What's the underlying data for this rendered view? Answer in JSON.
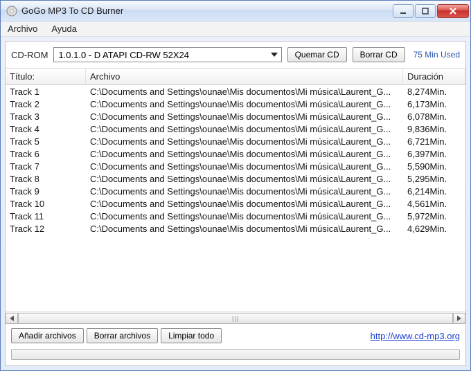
{
  "window": {
    "title": "GoGo MP3 To CD Burner"
  },
  "menu": {
    "archivo": "Archivo",
    "ayuda": "Ayuda"
  },
  "toolbar": {
    "cdrom_label": "CD-ROM",
    "drive_value": "1.0.1.0 - D  ATAPI   CD-RW 52X24",
    "burn_label": "Quemar CD",
    "erase_label": "Borrar CD",
    "min_used": "75 Min Used"
  },
  "columns": {
    "title": "Título:",
    "file": "Archivo",
    "duration": "Duración"
  },
  "tracks": [
    {
      "title": "Track 1",
      "file": "C:\\Documents and Settings\\ounae\\Mis documentos\\Mi música\\Laurent_G...",
      "duration": "8,274Min."
    },
    {
      "title": "Track 2",
      "file": "C:\\Documents and Settings\\ounae\\Mis documentos\\Mi música\\Laurent_G...",
      "duration": "6,173Min."
    },
    {
      "title": "Track 3",
      "file": "C:\\Documents and Settings\\ounae\\Mis documentos\\Mi música\\Laurent_G...",
      "duration": "6,078Min."
    },
    {
      "title": "Track 4",
      "file": "C:\\Documents and Settings\\ounae\\Mis documentos\\Mi música\\Laurent_G...",
      "duration": "9,836Min."
    },
    {
      "title": "Track 5",
      "file": "C:\\Documents and Settings\\ounae\\Mis documentos\\Mi música\\Laurent_G...",
      "duration": "6,721Min."
    },
    {
      "title": "Track 6",
      "file": "C:\\Documents and Settings\\ounae\\Mis documentos\\Mi música\\Laurent_G...",
      "duration": "6,397Min."
    },
    {
      "title": "Track 7",
      "file": "C:\\Documents and Settings\\ounae\\Mis documentos\\Mi música\\Laurent_G...",
      "duration": "5,590Min."
    },
    {
      "title": "Track 8",
      "file": "C:\\Documents and Settings\\ounae\\Mis documentos\\Mi música\\Laurent_G...",
      "duration": "5,295Min."
    },
    {
      "title": "Track 9",
      "file": "C:\\Documents and Settings\\ounae\\Mis documentos\\Mi música\\Laurent_G...",
      "duration": "6,214Min."
    },
    {
      "title": "Track 10",
      "file": "C:\\Documents and Settings\\ounae\\Mis documentos\\Mi música\\Laurent_G...",
      "duration": "4,561Min."
    },
    {
      "title": "Track 11",
      "file": "C:\\Documents and Settings\\ounae\\Mis documentos\\Mi música\\Laurent_G...",
      "duration": "5,972Min."
    },
    {
      "title": "Track 12",
      "file": "C:\\Documents and Settings\\ounae\\Mis documentos\\Mi música\\Laurent_G...",
      "duration": "4,629Min."
    }
  ],
  "footer": {
    "add_files": "Añadir archivos",
    "delete_files": "Borrar archivos",
    "clear_all": "Limpiar todo",
    "link_text": "http://www.cd-mp3.org"
  }
}
